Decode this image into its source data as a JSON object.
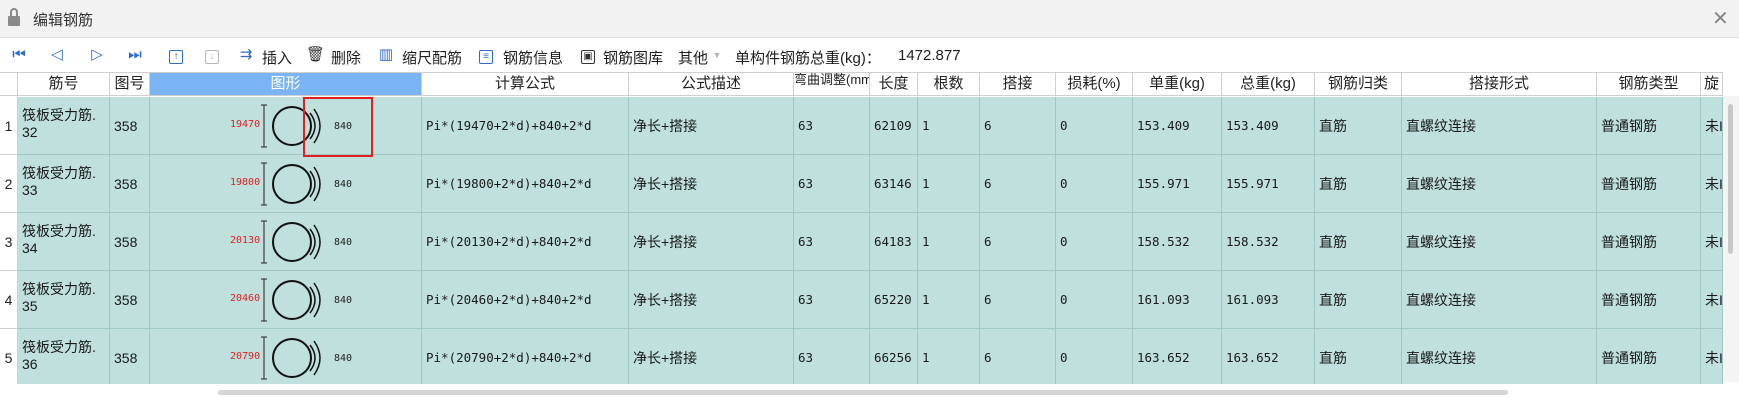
{
  "window": {
    "title": "编辑钢筋"
  },
  "toolbar": {
    "insert": "插入",
    "delete": "删除",
    "scale_rebar": "缩尺配筋",
    "rebar_info": "钢筋信息",
    "rebar_library": "钢筋图库",
    "other": "其他",
    "total_weight_label": "单构件钢筋总重(kg)：",
    "total_weight_value": "1472.877"
  },
  "table": {
    "headers": {
      "bar_no": "筋号",
      "fig_no": "图号",
      "shape": "图形",
      "formula": "计算公式",
      "desc": "公式描述",
      "bend_adjust": "弯曲调整(mm)",
      "length": "长度",
      "count": "根数",
      "lap": "搭接",
      "loss": "损耗(%)",
      "unit_weight": "单重(kg)",
      "total_weight": "总重(kg)",
      "category": "钢筋归类",
      "lap_type": "搭接形式",
      "rebar_type": "钢筋类型",
      "extra": "旋"
    },
    "rows": [
      {
        "idx": "1",
        "name1": "筏板受力筋.",
        "name2": "32",
        "fig": "358",
        "shape_left": "19470",
        "shape_right": "840",
        "formula": "Pi*(19470+2*d)+840+2*d",
        "desc": "净长+搭接",
        "bend": "63",
        "length": "62109",
        "count": "1",
        "lap": "6",
        "loss": "0",
        "unit": "153.409",
        "total": "153.409",
        "category": "直筋",
        "lap_type": "直螺纹连接",
        "rebar_type": "普通钢筋",
        "extra": "未I"
      },
      {
        "idx": "2",
        "name1": "筏板受力筋.",
        "name2": "33",
        "fig": "358",
        "shape_left": "19800",
        "shape_right": "840",
        "formula": "Pi*(19800+2*d)+840+2*d",
        "desc": "净长+搭接",
        "bend": "63",
        "length": "63146",
        "count": "1",
        "lap": "6",
        "loss": "0",
        "unit": "155.971",
        "total": "155.971",
        "category": "直筋",
        "lap_type": "直螺纹连接",
        "rebar_type": "普通钢筋",
        "extra": "未I"
      },
      {
        "idx": "3",
        "name1": "筏板受力筋.",
        "name2": "34",
        "fig": "358",
        "shape_left": "20130",
        "shape_right": "840",
        "formula": "Pi*(20130+2*d)+840+2*d",
        "desc": "净长+搭接",
        "bend": "63",
        "length": "64183",
        "count": "1",
        "lap": "6",
        "loss": "0",
        "unit": "158.532",
        "total": "158.532",
        "category": "直筋",
        "lap_type": "直螺纹连接",
        "rebar_type": "普通钢筋",
        "extra": "未I"
      },
      {
        "idx": "4",
        "name1": "筏板受力筋.",
        "name2": "35",
        "fig": "358",
        "shape_left": "20460",
        "shape_right": "840",
        "formula": "Pi*(20460+2*d)+840+2*d",
        "desc": "净长+搭接",
        "bend": "63",
        "length": "65220",
        "count": "1",
        "lap": "6",
        "loss": "0",
        "unit": "161.093",
        "total": "161.093",
        "category": "直筋",
        "lap_type": "直螺纹连接",
        "rebar_type": "普通钢筋",
        "extra": "未I"
      },
      {
        "idx": "5",
        "name1": "筏板受力筋.",
        "name2": "36",
        "fig": "358",
        "shape_left": "20790",
        "shape_right": "840",
        "formula": "Pi*(20790+2*d)+840+2*d",
        "desc": "净长+搭接",
        "bend": "63",
        "length": "66256",
        "count": "1",
        "lap": "6",
        "loss": "0",
        "unit": "163.652",
        "total": "163.652",
        "category": "直筋",
        "lap_type": "直螺纹连接",
        "rebar_type": "普通钢筋",
        "extra": "未I"
      }
    ]
  },
  "icons": [
    "lock-icon",
    "close-icon",
    "first-icon",
    "prev-icon",
    "next-icon",
    "last-icon",
    "move-up-icon",
    "move-down-icon",
    "insert-icon",
    "delete-icon",
    "scale-rebar-icon",
    "rebar-info-icon",
    "rebar-library-icon",
    "dropdown-icon"
  ],
  "colors": {
    "row_bg": "#bfe0dd",
    "selected_header": "#7ab4f5",
    "accent_blue": "#2f6ad0",
    "dimension_red": "#e02020"
  }
}
